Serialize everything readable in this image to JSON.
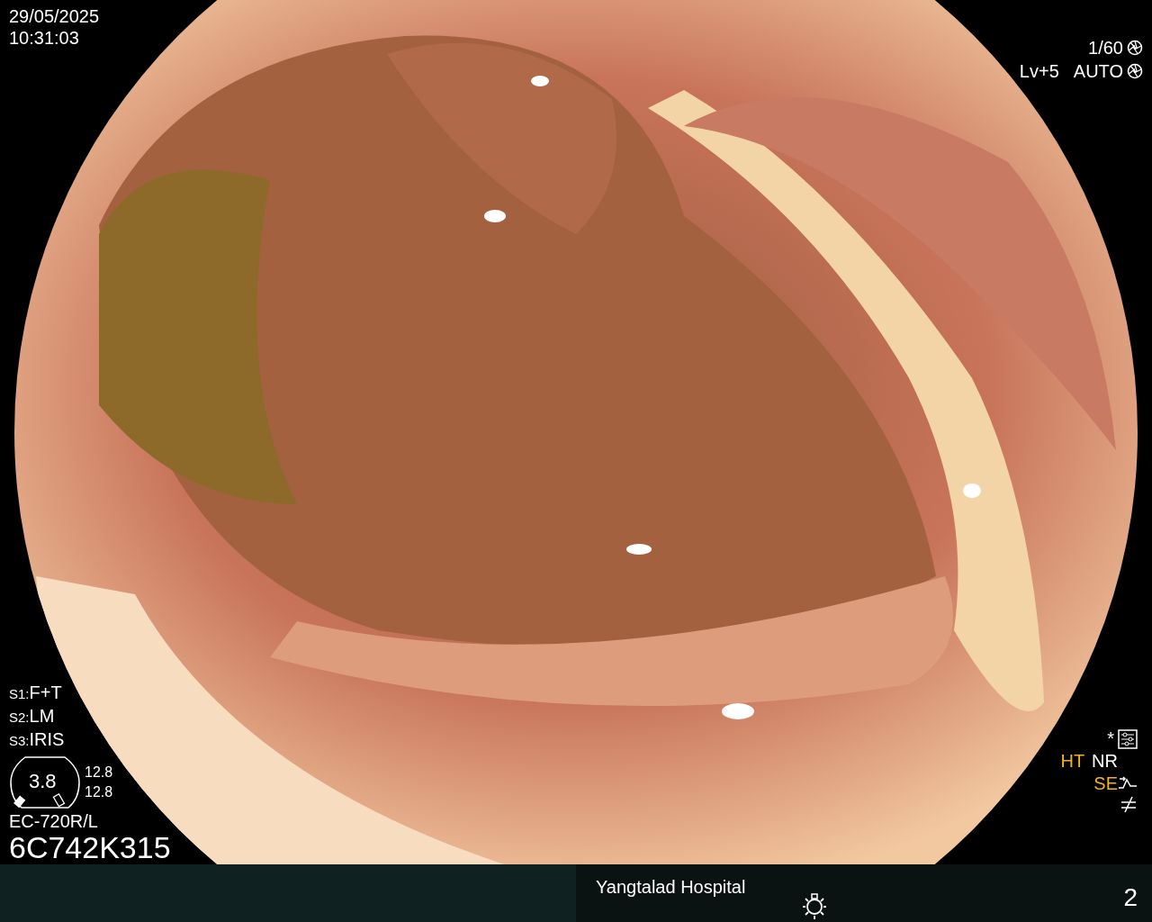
{
  "datetime": {
    "date": "29/05/2025",
    "time": "10:31:03"
  },
  "exposure": {
    "shutter": "1/60",
    "brightness": "Lv+5",
    "iris_mode": "AUTO"
  },
  "scope_switches": [
    {
      "label": "S1:",
      "value": "F+T"
    },
    {
      "label": "S2:",
      "value": "LM"
    },
    {
      "label": "S3:",
      "value": "IRIS"
    }
  ],
  "zoom_gauge": {
    "value": "3.8",
    "readings": [
      "12.8",
      "12.8"
    ]
  },
  "scope_model": "EC-720R/L",
  "serial": "6C742K315",
  "asterisk": "*",
  "image_modes": [
    {
      "label": "HT",
      "on": true
    },
    {
      "label": "NR",
      "on": false
    },
    {
      "label": "SE",
      "on": true
    }
  ],
  "footer": {
    "hospital": "Yangtalad Hospital",
    "page": "2"
  }
}
